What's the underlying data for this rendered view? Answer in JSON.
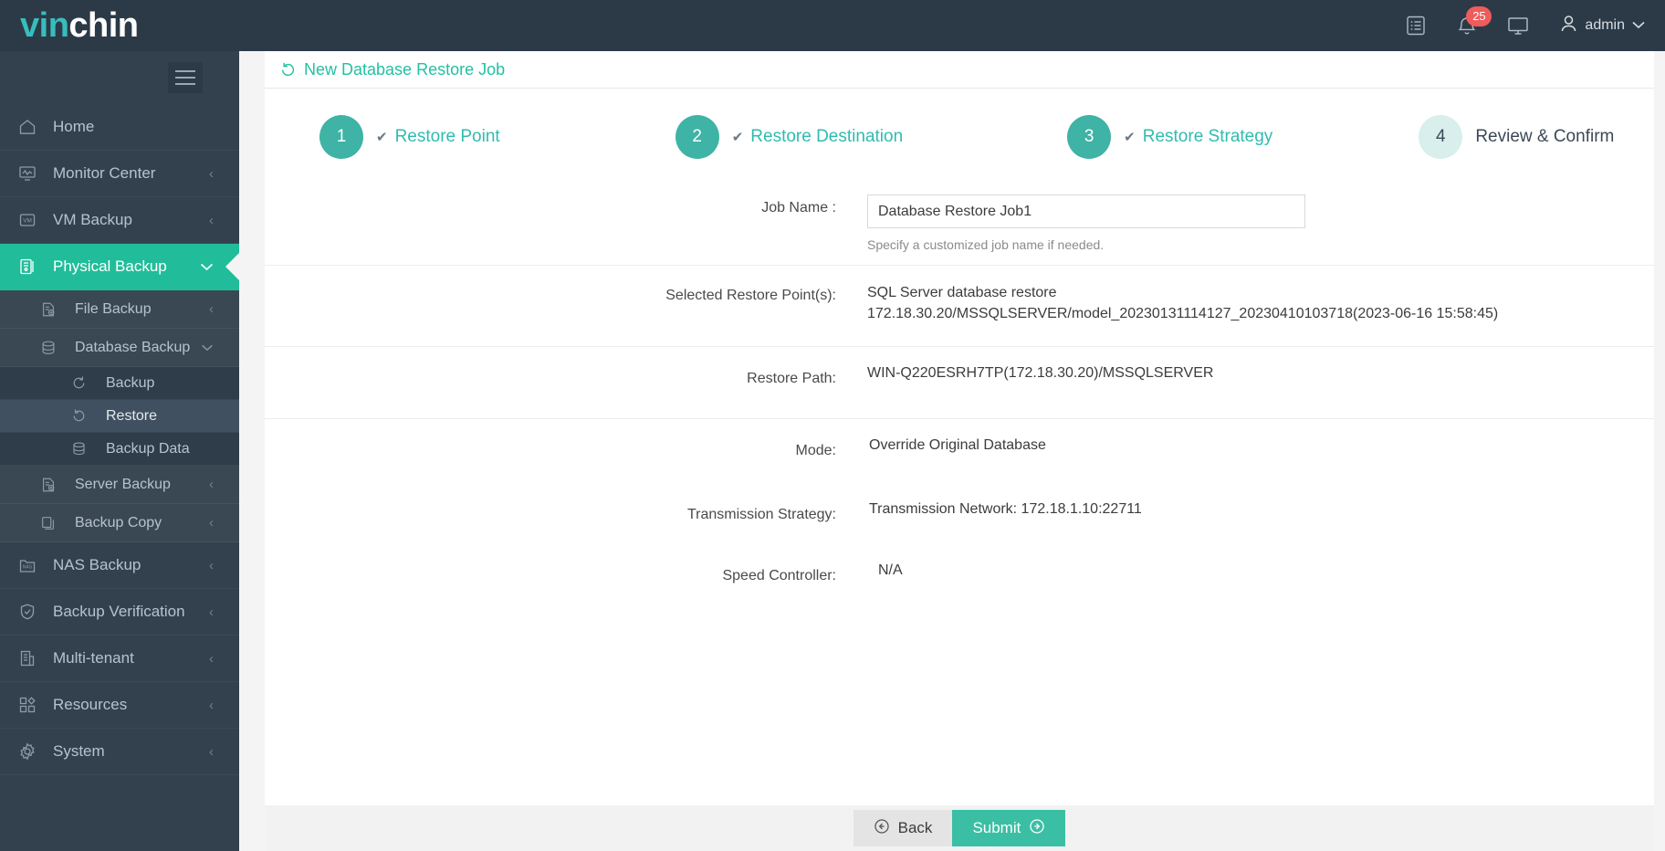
{
  "header": {
    "logo_first": "vin",
    "logo_second": "chin",
    "log_icon": "list-document-icon",
    "notification_icon": "bell-icon",
    "notification_count": "25",
    "console_icon": "monitor-icon",
    "user_icon": "user-icon",
    "user_name": "admin",
    "user_caret_icon": "chevron-down-icon"
  },
  "sidebar": {
    "toggle_icon": "hamburger-icon",
    "items": [
      {
        "label": "Home",
        "icon": "home-icon",
        "arrow": "",
        "level": 0,
        "active": false
      },
      {
        "label": "Monitor Center",
        "icon": "monitor-chart-icon",
        "arrow": "‹",
        "level": 0,
        "active": false
      },
      {
        "label": "VM Backup",
        "icon": "vm-icon",
        "arrow": "‹",
        "level": 0,
        "active": false
      },
      {
        "label": "Physical Backup",
        "icon": "server-icon",
        "arrow": "∨",
        "level": 0,
        "active": true
      },
      {
        "label": "File Backup",
        "icon": "file-add-icon",
        "arrow": "‹",
        "level": 1,
        "active": false
      },
      {
        "label": "Database Backup",
        "icon": "database-icon",
        "arrow": "∨",
        "level": 1,
        "active": false
      },
      {
        "label": "Backup",
        "icon": "refresh-cw-icon",
        "arrow": "",
        "level": 2,
        "active": false
      },
      {
        "label": "Restore",
        "icon": "restore-ccw-icon",
        "arrow": "",
        "level": 2,
        "active": true
      },
      {
        "label": "Backup Data",
        "icon": "database-icon",
        "arrow": "",
        "level": 2,
        "active": false
      },
      {
        "label": "Server Backup",
        "icon": "file-add-icon",
        "arrow": "‹",
        "level": 1,
        "active": false
      },
      {
        "label": "Backup Copy",
        "icon": "copy-icon",
        "arrow": "‹",
        "level": 1,
        "active": false
      },
      {
        "label": "NAS Backup",
        "icon": "nas-folder-icon",
        "arrow": "‹",
        "level": 0,
        "active": false
      },
      {
        "label": "Backup Verification",
        "icon": "shield-check-icon",
        "arrow": "‹",
        "level": 0,
        "active": false
      },
      {
        "label": "Multi-tenant",
        "icon": "building-icon",
        "arrow": "‹",
        "level": 0,
        "active": false
      },
      {
        "label": "Resources",
        "icon": "grid-icon",
        "arrow": "‹",
        "level": 0,
        "active": false
      },
      {
        "label": "System",
        "icon": "gear-icon",
        "arrow": "‹",
        "level": 0,
        "active": false
      }
    ]
  },
  "panel": {
    "title_icon": "restore-ccw-icon",
    "title": "New Database Restore Job"
  },
  "stepper": {
    "steps": [
      {
        "number": "1",
        "label": "Restore Point",
        "done": true
      },
      {
        "number": "2",
        "label": "Restore Destination",
        "done": true
      },
      {
        "number": "3",
        "label": "Restore Strategy",
        "done": true
      },
      {
        "number": "4",
        "label": "Review & Confirm",
        "done": false
      }
    ],
    "check_icon": "check-icon"
  },
  "form": {
    "job_name": {
      "label": "Job Name :",
      "value": "Database Restore Job1",
      "placeholder": "",
      "hint": "Specify a customized job name if needed."
    },
    "restore_points": {
      "label": "Selected Restore Point(s):",
      "line1": "SQL Server database restore",
      "line2": "172.18.30.20/MSSQLSERVER/model_20230131114127_20230410103718(2023-06-16 15:58:45)"
    },
    "restore_path": {
      "label": "Restore Path:",
      "value": "WIN-Q220ESRH7TP(172.18.30.20)/MSSQLSERVER"
    },
    "mode": {
      "label": "Mode:",
      "value": "Override Original Database"
    },
    "transmission_strategy": {
      "label": "Transmission Strategy:",
      "value": "Transmission Network: 172.18.1.10:22711"
    },
    "speed_controller": {
      "label": "Speed Controller:",
      "value": "N/A"
    }
  },
  "footer": {
    "back_label": "Back",
    "back_icon": "arrow-left-circle-icon",
    "submit_label": "Submit",
    "submit_icon": "arrow-right-circle-icon"
  },
  "colors": {
    "accent_teal": "#21bd9a",
    "header_dark": "#2c3a47",
    "sidebar_dark": "#33414f",
    "badge_red": "#f05b5b",
    "step_teal": "#3eb3a6",
    "step_pending": "#d8efeb"
  }
}
